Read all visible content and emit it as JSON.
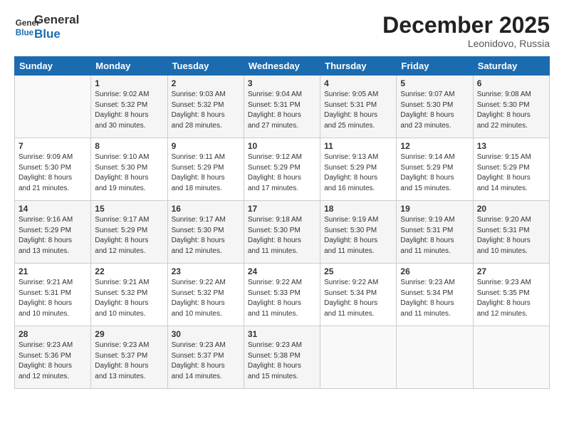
{
  "header": {
    "logo_line1": "General",
    "logo_line2": "Blue",
    "month": "December 2025",
    "location": "Leonidovo, Russia"
  },
  "weekdays": [
    "Sunday",
    "Monday",
    "Tuesday",
    "Wednesday",
    "Thursday",
    "Friday",
    "Saturday"
  ],
  "weeks": [
    [
      {
        "day": "",
        "info": ""
      },
      {
        "day": "1",
        "info": "Sunrise: 9:02 AM\nSunset: 5:32 PM\nDaylight: 8 hours\nand 30 minutes."
      },
      {
        "day": "2",
        "info": "Sunrise: 9:03 AM\nSunset: 5:32 PM\nDaylight: 8 hours\nand 28 minutes."
      },
      {
        "day": "3",
        "info": "Sunrise: 9:04 AM\nSunset: 5:31 PM\nDaylight: 8 hours\nand 27 minutes."
      },
      {
        "day": "4",
        "info": "Sunrise: 9:05 AM\nSunset: 5:31 PM\nDaylight: 8 hours\nand 25 minutes."
      },
      {
        "day": "5",
        "info": "Sunrise: 9:07 AM\nSunset: 5:30 PM\nDaylight: 8 hours\nand 23 minutes."
      },
      {
        "day": "6",
        "info": "Sunrise: 9:08 AM\nSunset: 5:30 PM\nDaylight: 8 hours\nand 22 minutes."
      }
    ],
    [
      {
        "day": "7",
        "info": "Sunrise: 9:09 AM\nSunset: 5:30 PM\nDaylight: 8 hours\nand 21 minutes."
      },
      {
        "day": "8",
        "info": "Sunrise: 9:10 AM\nSunset: 5:30 PM\nDaylight: 8 hours\nand 19 minutes."
      },
      {
        "day": "9",
        "info": "Sunrise: 9:11 AM\nSunset: 5:29 PM\nDaylight: 8 hours\nand 18 minutes."
      },
      {
        "day": "10",
        "info": "Sunrise: 9:12 AM\nSunset: 5:29 PM\nDaylight: 8 hours\nand 17 minutes."
      },
      {
        "day": "11",
        "info": "Sunrise: 9:13 AM\nSunset: 5:29 PM\nDaylight: 8 hours\nand 16 minutes."
      },
      {
        "day": "12",
        "info": "Sunrise: 9:14 AM\nSunset: 5:29 PM\nDaylight: 8 hours\nand 15 minutes."
      },
      {
        "day": "13",
        "info": "Sunrise: 9:15 AM\nSunset: 5:29 PM\nDaylight: 8 hours\nand 14 minutes."
      }
    ],
    [
      {
        "day": "14",
        "info": "Sunrise: 9:16 AM\nSunset: 5:29 PM\nDaylight: 8 hours\nand 13 minutes."
      },
      {
        "day": "15",
        "info": "Sunrise: 9:17 AM\nSunset: 5:29 PM\nDaylight: 8 hours\nand 12 minutes."
      },
      {
        "day": "16",
        "info": "Sunrise: 9:17 AM\nSunset: 5:30 PM\nDaylight: 8 hours\nand 12 minutes."
      },
      {
        "day": "17",
        "info": "Sunrise: 9:18 AM\nSunset: 5:30 PM\nDaylight: 8 hours\nand 11 minutes."
      },
      {
        "day": "18",
        "info": "Sunrise: 9:19 AM\nSunset: 5:30 PM\nDaylight: 8 hours\nand 11 minutes."
      },
      {
        "day": "19",
        "info": "Sunrise: 9:19 AM\nSunset: 5:31 PM\nDaylight: 8 hours\nand 11 minutes."
      },
      {
        "day": "20",
        "info": "Sunrise: 9:20 AM\nSunset: 5:31 PM\nDaylight: 8 hours\nand 10 minutes."
      }
    ],
    [
      {
        "day": "21",
        "info": "Sunrise: 9:21 AM\nSunset: 5:31 PM\nDaylight: 8 hours\nand 10 minutes."
      },
      {
        "day": "22",
        "info": "Sunrise: 9:21 AM\nSunset: 5:32 PM\nDaylight: 8 hours\nand 10 minutes."
      },
      {
        "day": "23",
        "info": "Sunrise: 9:22 AM\nSunset: 5:32 PM\nDaylight: 8 hours\nand 10 minutes."
      },
      {
        "day": "24",
        "info": "Sunrise: 9:22 AM\nSunset: 5:33 PM\nDaylight: 8 hours\nand 11 minutes."
      },
      {
        "day": "25",
        "info": "Sunrise: 9:22 AM\nSunset: 5:34 PM\nDaylight: 8 hours\nand 11 minutes."
      },
      {
        "day": "26",
        "info": "Sunrise: 9:23 AM\nSunset: 5:34 PM\nDaylight: 8 hours\nand 11 minutes."
      },
      {
        "day": "27",
        "info": "Sunrise: 9:23 AM\nSunset: 5:35 PM\nDaylight: 8 hours\nand 12 minutes."
      }
    ],
    [
      {
        "day": "28",
        "info": "Sunrise: 9:23 AM\nSunset: 5:36 PM\nDaylight: 8 hours\nand 12 minutes."
      },
      {
        "day": "29",
        "info": "Sunrise: 9:23 AM\nSunset: 5:37 PM\nDaylight: 8 hours\nand 13 minutes."
      },
      {
        "day": "30",
        "info": "Sunrise: 9:23 AM\nSunset: 5:37 PM\nDaylight: 8 hours\nand 14 minutes."
      },
      {
        "day": "31",
        "info": "Sunrise: 9:23 AM\nSunset: 5:38 PM\nDaylight: 8 hours\nand 15 minutes."
      },
      {
        "day": "",
        "info": ""
      },
      {
        "day": "",
        "info": ""
      },
      {
        "day": "",
        "info": ""
      }
    ]
  ]
}
